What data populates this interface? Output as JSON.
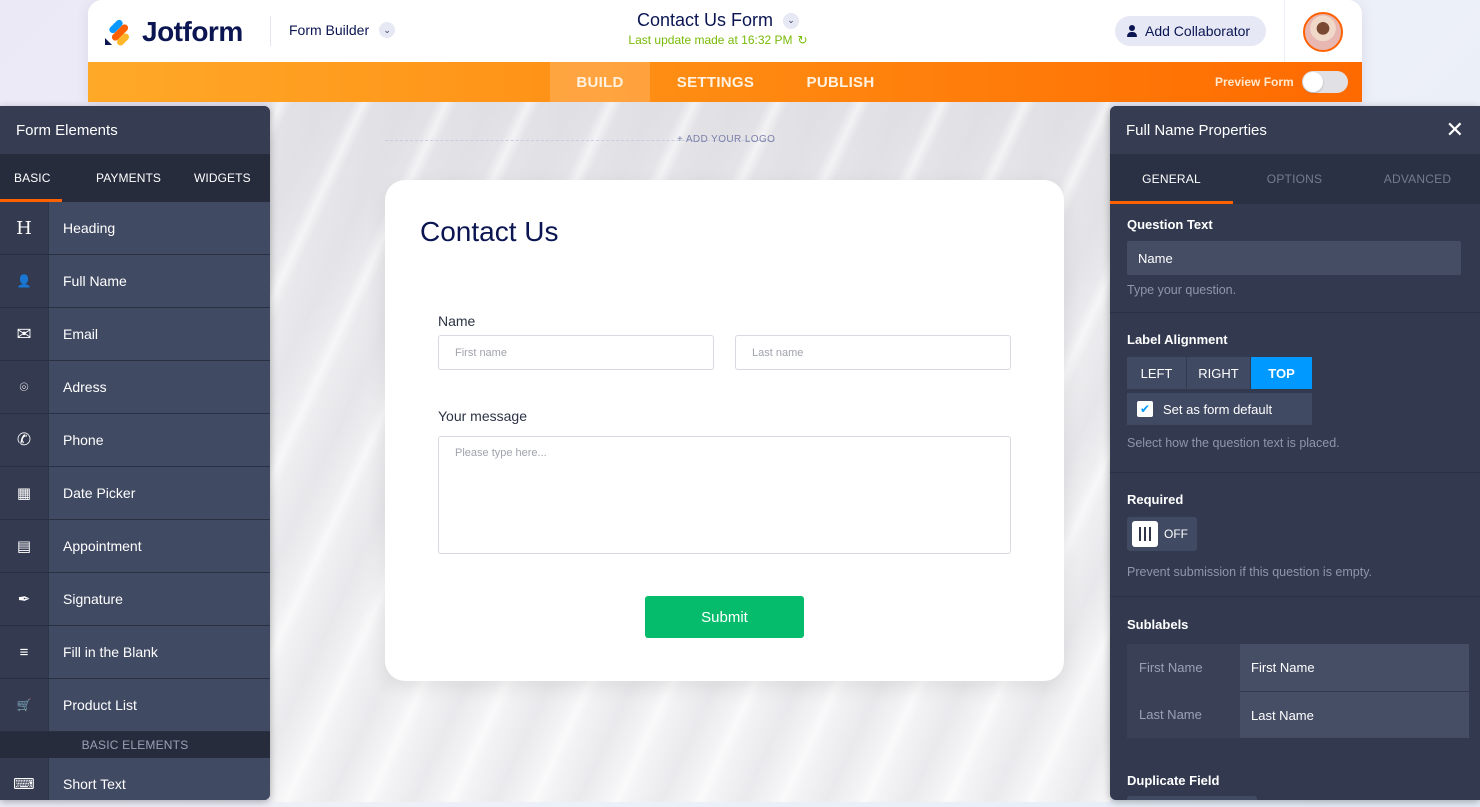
{
  "header": {
    "brand": "Jotform",
    "mode_label": "Form Builder",
    "form_title": "Contact Us Form",
    "last_update": "Last update made at 16:32 PM",
    "add_collaborator_label": "Add Collaborator",
    "nav_tabs": [
      {
        "label": "BUILD",
        "active": true
      },
      {
        "label": "SETTINGS",
        "active": false
      },
      {
        "label": "PUBLISH",
        "active": false
      }
    ],
    "preview_label": "Preview Form",
    "preview_enabled": false,
    "colors": {
      "accent": "#ff6100",
      "brand_dark": "#0a1551",
      "update_green": "#78bb07"
    }
  },
  "left_panel": {
    "title": "Form Elements",
    "tabs": [
      {
        "label": "BASIC",
        "active": true
      },
      {
        "label": "PAYMENTS",
        "active": false
      },
      {
        "label": "WIDGETS",
        "active": false
      }
    ],
    "items": [
      {
        "label": "Heading",
        "icon": "heading-icon",
        "glyph": "H"
      },
      {
        "label": "Full Name",
        "icon": "user-circle-icon",
        "glyph": "👤"
      },
      {
        "label": "Email",
        "icon": "envelope-icon",
        "glyph": "✉"
      },
      {
        "label": "Adress",
        "icon": "location-pin-icon",
        "glyph": "⌾"
      },
      {
        "label": "Phone",
        "icon": "phone-icon",
        "glyph": "✆"
      },
      {
        "label": "Date Picker",
        "icon": "calendar-icon",
        "glyph": "▦"
      },
      {
        "label": "Appointment",
        "icon": "appointment-calendar-icon",
        "glyph": "▤"
      },
      {
        "label": "Signature",
        "icon": "pen-nib-icon",
        "glyph": "✒"
      },
      {
        "label": "Fill in the Blank",
        "icon": "fill-blank-icon",
        "glyph": "≡"
      },
      {
        "label": "Product List",
        "icon": "cart-icon",
        "glyph": "🛒"
      }
    ],
    "section_label": "BASIC ELEMENTS",
    "section_items": [
      {
        "label": "Short Text",
        "icon": "short-text-icon",
        "glyph": "⌨"
      }
    ]
  },
  "canvas": {
    "add_logo": "+ ADD YOUR LOGO",
    "form_heading": "Contact Us",
    "name_label": "Name",
    "first_name_placeholder": "First name",
    "last_name_placeholder": "Last name",
    "message_label": "Your message",
    "message_placeholder": "Please type here...",
    "submit_label": "Submit",
    "submit_color": "#04bc6c"
  },
  "right_panel": {
    "title": "Full Name Properties",
    "tabs": [
      {
        "label": "GENERAL",
        "active": true
      },
      {
        "label": "OPTIONS",
        "active": false
      },
      {
        "label": "ADVANCED",
        "active": false
      }
    ],
    "question_text": {
      "label": "Question Text",
      "value": "Name",
      "help": "Type your question."
    },
    "label_alignment": {
      "label": "Label Alignment",
      "options": [
        "LEFT",
        "RIGHT",
        "TOP"
      ],
      "selected": "TOP",
      "default_label": "Set as form default",
      "default_checked": true,
      "help": "Select how the question text is placed."
    },
    "required": {
      "label": "Required",
      "state": "OFF",
      "help": "Prevent submission if this question is empty."
    },
    "sublabels": {
      "label": "Sublabels",
      "rows": [
        {
          "key": "First Name",
          "value": "First Name"
        },
        {
          "key": "Last Name",
          "value": "Last Name"
        }
      ]
    },
    "duplicate_field": {
      "label": "Duplicate Field"
    },
    "colors": {
      "selected_option": "#0099ff"
    }
  }
}
